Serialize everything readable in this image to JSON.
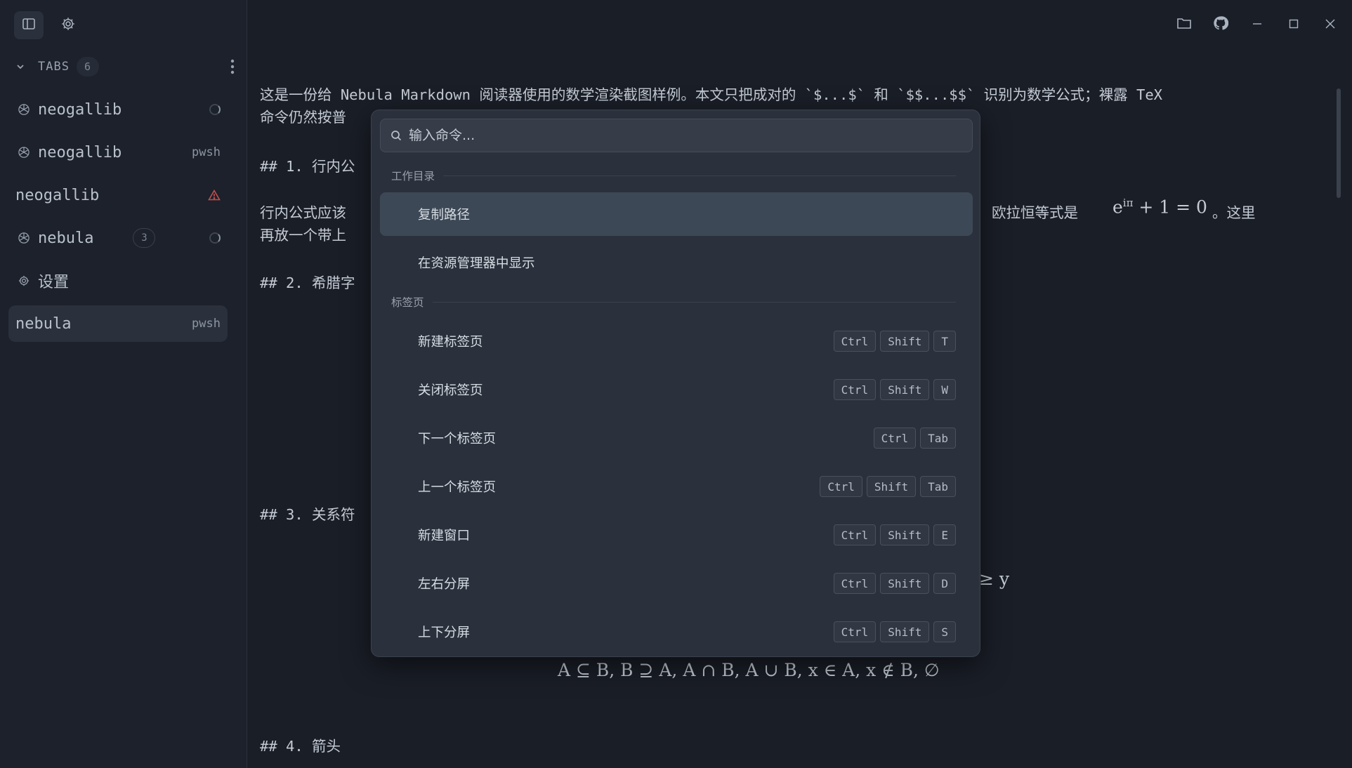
{
  "sidebar": {
    "tabs_header": {
      "label": "TABS",
      "count": "6"
    },
    "items": [
      {
        "label": "neogallib",
        "icon": "openai-icon",
        "status": "loading-spinner"
      },
      {
        "label": "neogallib",
        "icon": "openai-icon",
        "right_text": "pwsh"
      },
      {
        "label": "neogallib",
        "icon": "",
        "status": "warning-icon"
      },
      {
        "label": "nebula",
        "icon": "openai-icon",
        "badge": "3",
        "status": "loading-spinner"
      },
      {
        "label": "设置",
        "icon": "gear-icon"
      },
      {
        "label": "nebula",
        "icon": "",
        "right_text": "pwsh",
        "active": true
      }
    ]
  },
  "document": {
    "lines": [
      "这是一份给 Nebula Markdown 阅读器使用的数学渲染截图样例。本文只把成对的 `$...$` 和 `$$...$$` 识别为数学公式；裸露 TeX",
      "命令仍然按普",
      "## 1. 行内公",
      "行内公式应该",
      "欧拉恒等式是",
      "。这里",
      "再放一个带上",
      "## 2. 希腊字",
      "## 3. 关系符",
      "## 4. 箭头"
    ],
    "math": {
      "euler": "e",
      "euler_sup": "iπ",
      "euler_rest": "+ 1 = 0",
      "relation_fragment": "≥ y",
      "sets": "A ⊆ B,    B ⊇ A,    A ∩ B,    A ∪ B,    x ∈ A,    x ∉ B,    ∅"
    }
  },
  "palette": {
    "search_placeholder": "输入命令...",
    "sections": [
      {
        "title": "工作目录",
        "commands": [
          {
            "label": "复制路径",
            "keys": [],
            "selected": true
          },
          {
            "label": "在资源管理器中显示",
            "keys": []
          }
        ]
      },
      {
        "title": "标签页",
        "commands": [
          {
            "label": "新建标签页",
            "keys": [
              "Ctrl",
              "Shift",
              "T"
            ]
          },
          {
            "label": "关闭标签页",
            "keys": [
              "Ctrl",
              "Shift",
              "W"
            ]
          },
          {
            "label": "下一个标签页",
            "keys": [
              "Ctrl",
              "Tab"
            ]
          },
          {
            "label": "上一个标签页",
            "keys": [
              "Ctrl",
              "Shift",
              "Tab"
            ]
          },
          {
            "label": "新建窗口",
            "keys": [
              "Ctrl",
              "Shift",
              "E"
            ]
          },
          {
            "label": "左右分屏",
            "keys": [
              "Ctrl",
              "Shift",
              "D"
            ]
          },
          {
            "label": "上下分屏",
            "keys": [
              "Ctrl",
              "Shift",
              "S"
            ]
          }
        ]
      }
    ]
  },
  "colors": {
    "accent_selected": "#3d4856",
    "warning": "#c0504d",
    "background": "#1a1e27"
  }
}
